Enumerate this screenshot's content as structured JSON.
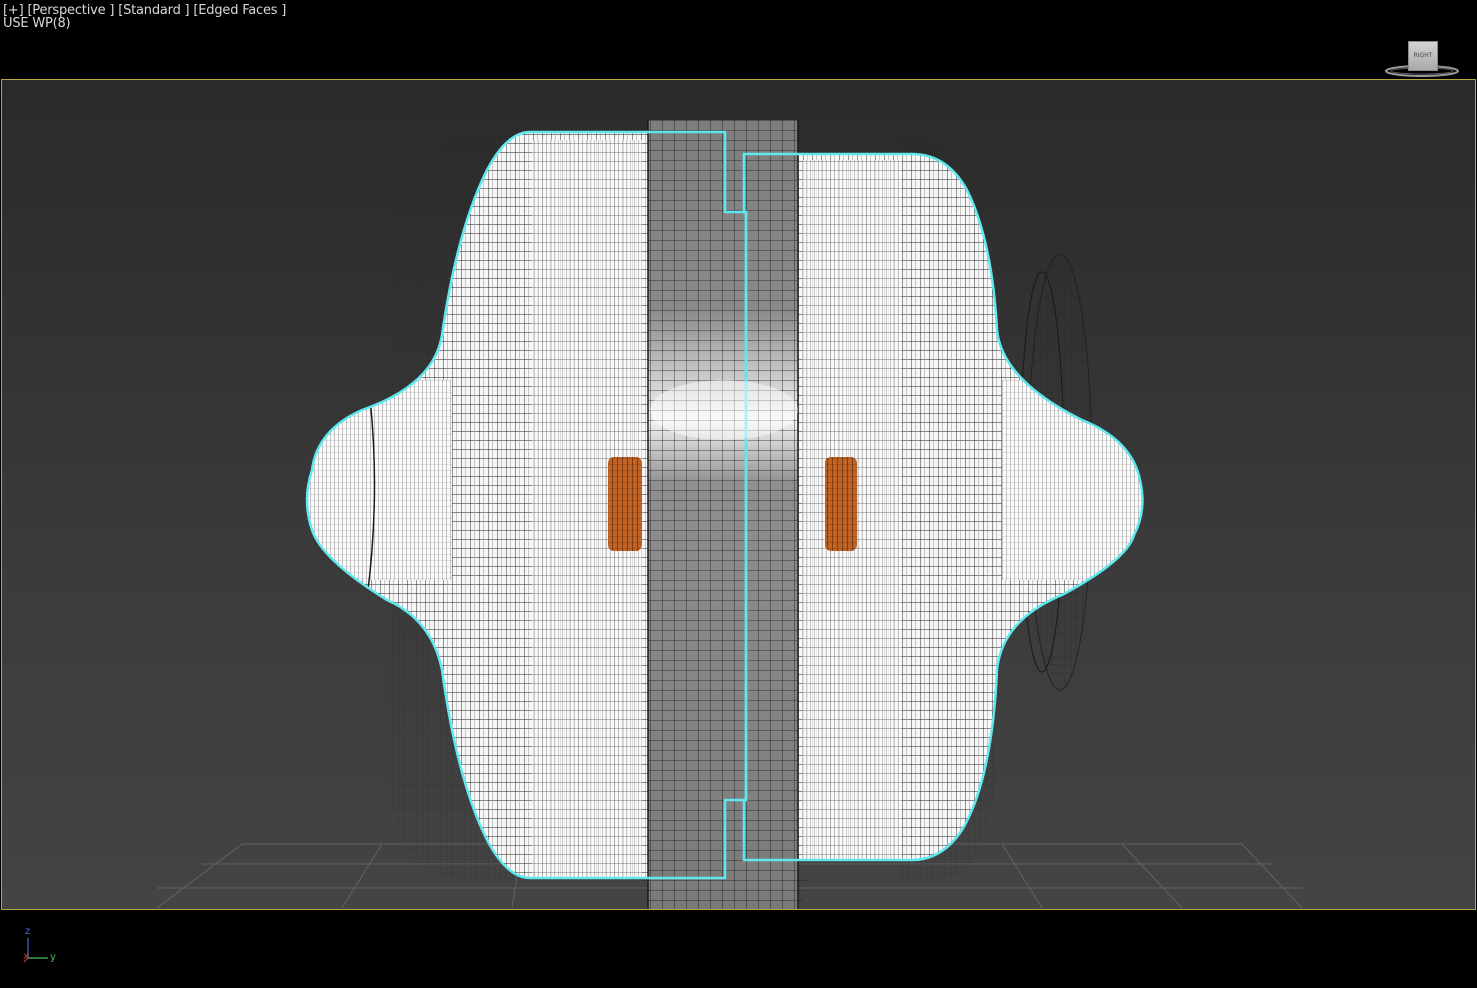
{
  "viewport_menu": {
    "plus": "[+]",
    "view": "[Perspective ]",
    "shading": "[Standard ]",
    "display": "[Edged Faces ]"
  },
  "status": {
    "workplane": "USE WP(8)"
  },
  "viewcube": {
    "face_label": "RIGHT"
  },
  "axis_tripod": {
    "z": "z",
    "x": "x",
    "y": "y"
  },
  "colors": {
    "selection_outline": "#5ee8ee",
    "viewport_border": "#b3a93a",
    "accent_orange": "#b5561a",
    "axis_z": "#4a6cd0",
    "axis_x": "#d03a3a",
    "axis_y": "#4fbf4f"
  }
}
